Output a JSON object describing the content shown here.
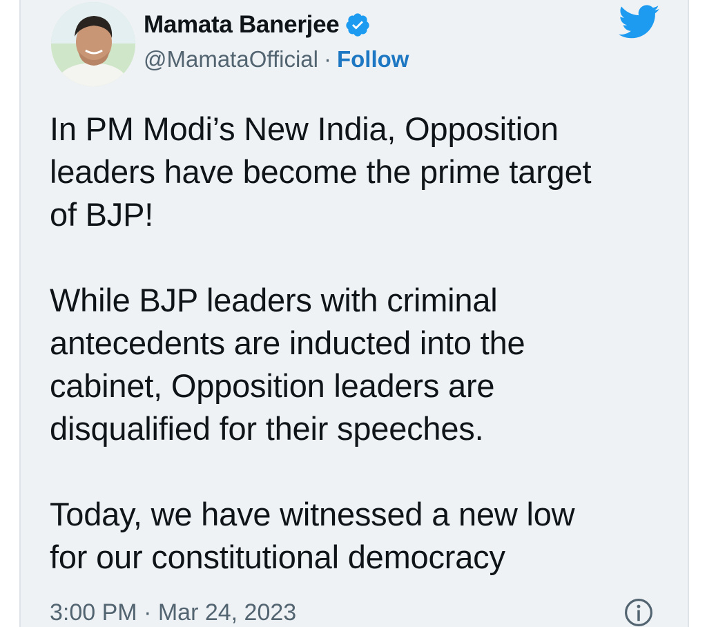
{
  "author": {
    "display_name": "Mamata Banerjee",
    "handle": "@MamataOfficial",
    "separator": "·",
    "follow_label": "Follow",
    "avatar_icon": "avatar-photo",
    "verified_icon": "verified-badge-icon"
  },
  "brand": {
    "icon": "twitter-bird-icon",
    "color": "#1d9bf0"
  },
  "tweet": {
    "paragraphs": [
      "In PM Modi’s New India, Opposition\nleaders have become the prime target\nof BJP!",
      "While BJP leaders with criminal\nantecedents are inducted into the\ncabinet, Opposition leaders are\ndisqualified for their speeches.",
      "Today, we have witnessed a new low\nfor our constitutional democracy"
    ]
  },
  "meta": {
    "timestamp": "3:00 PM · Mar 24, 2023",
    "info_icon": "info-icon"
  },
  "colors": {
    "card_background": "#eef2f5",
    "text": "#0f1419",
    "secondary": "#536471",
    "link": "#1d77c2"
  }
}
